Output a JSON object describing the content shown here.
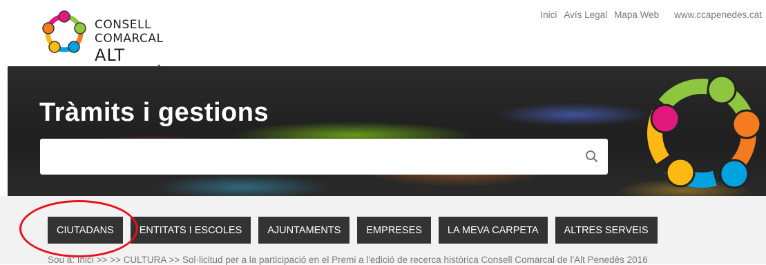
{
  "header": {
    "logo": {
      "line1": "CONSELL COMARCAL",
      "line2": "ALT PENEDÈS"
    },
    "top_links": [
      {
        "label": "Inici"
      },
      {
        "label": "Avís Legal"
      },
      {
        "label": "Mapa Web"
      },
      {
        "label": "www.ccapenedes.cat"
      }
    ]
  },
  "hero": {
    "title": "Tràmits i gestions",
    "search": {
      "value": "",
      "placeholder": "",
      "icon": "search-icon"
    }
  },
  "nav": {
    "items": [
      {
        "label": "CIUTADANS",
        "highlighted": true
      },
      {
        "label": "ENTITATS I ESCOLES"
      },
      {
        "label": "AJUNTAMENTS"
      },
      {
        "label": "EMPRESES"
      },
      {
        "label": "LA MEVA CARPETA"
      },
      {
        "label": "ALTRES SERVEIS"
      }
    ]
  },
  "breadcrumb": {
    "prefix": "Sou a:",
    "home": "Inici",
    "sep1": ">> >>",
    "section": "CULTURA",
    "sep2": ">>",
    "current": "Sol·licitud per a la participació en el Premi a l'edició de recerca històrica Consell Comarcal de l'Alt Penedès 2016"
  },
  "colors": {
    "nav_button_bg": "#333333",
    "highlight_ring": "#e8101c",
    "logo_ring_colors": [
      "#8dc63f",
      "#f47b20",
      "#e2197c",
      "#00a3e0",
      "#fdb913"
    ]
  }
}
